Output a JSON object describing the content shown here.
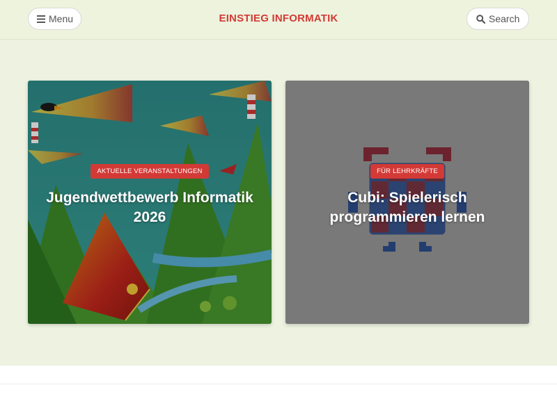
{
  "header": {
    "menu_label": "Menu",
    "site_title": "EINSTIEG INFORMATIK",
    "search_label": "Search"
  },
  "cards": [
    {
      "category": "AKTUELLE VERANSTALTUNGEN",
      "title": "Jugendwettbewerb Informatik 2026"
    },
    {
      "category": "FÜR LEHRKRÄFTE",
      "title": "Cubi: Spielerisch programmieren lernen"
    }
  ],
  "icons": [
    "hamburger-menu-icon",
    "search-icon"
  ],
  "colors": {
    "accent": "#d23a35",
    "header_bg": "#eef3dd",
    "band_bg": "#eef3e1",
    "card2_bg": "#9b9b9b"
  }
}
